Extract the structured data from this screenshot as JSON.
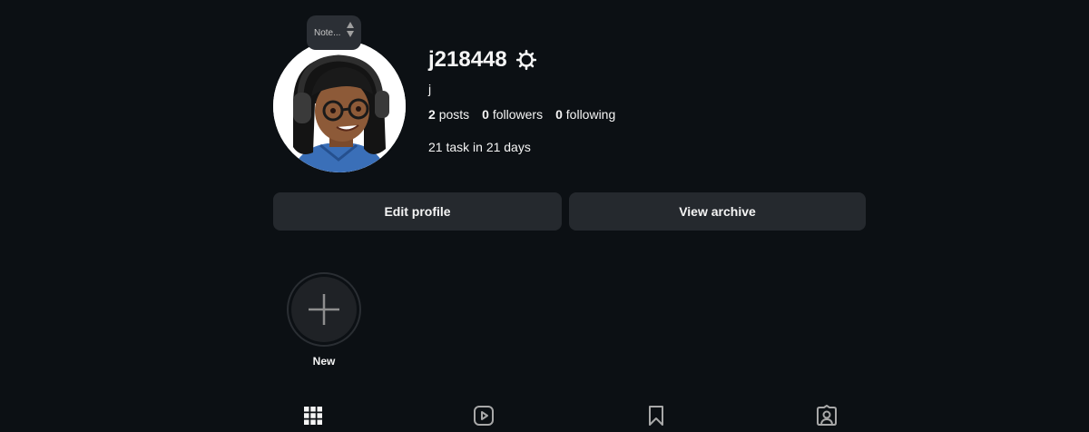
{
  "profile": {
    "username": "j218448",
    "full_name": "j",
    "bio": "21 task in 21 days",
    "note_placeholder": "Note...",
    "stats": {
      "posts_count": "2",
      "posts_label": "posts",
      "followers_count": "0",
      "followers_label": "followers",
      "following_count": "0",
      "following_label": "following"
    }
  },
  "actions": {
    "edit_profile": "Edit profile",
    "view_archive": "View archive"
  },
  "highlights": {
    "new_label": "New"
  },
  "tabs": [
    {
      "icon": "grid-icon",
      "active": true
    },
    {
      "icon": "reels-icon",
      "active": false
    },
    {
      "icon": "saved-icon",
      "active": false
    },
    {
      "icon": "tagged-icon",
      "active": false
    }
  ],
  "colors": {
    "background": "#0c1014",
    "button": "#25292e",
    "text": "#f5f5f5"
  }
}
